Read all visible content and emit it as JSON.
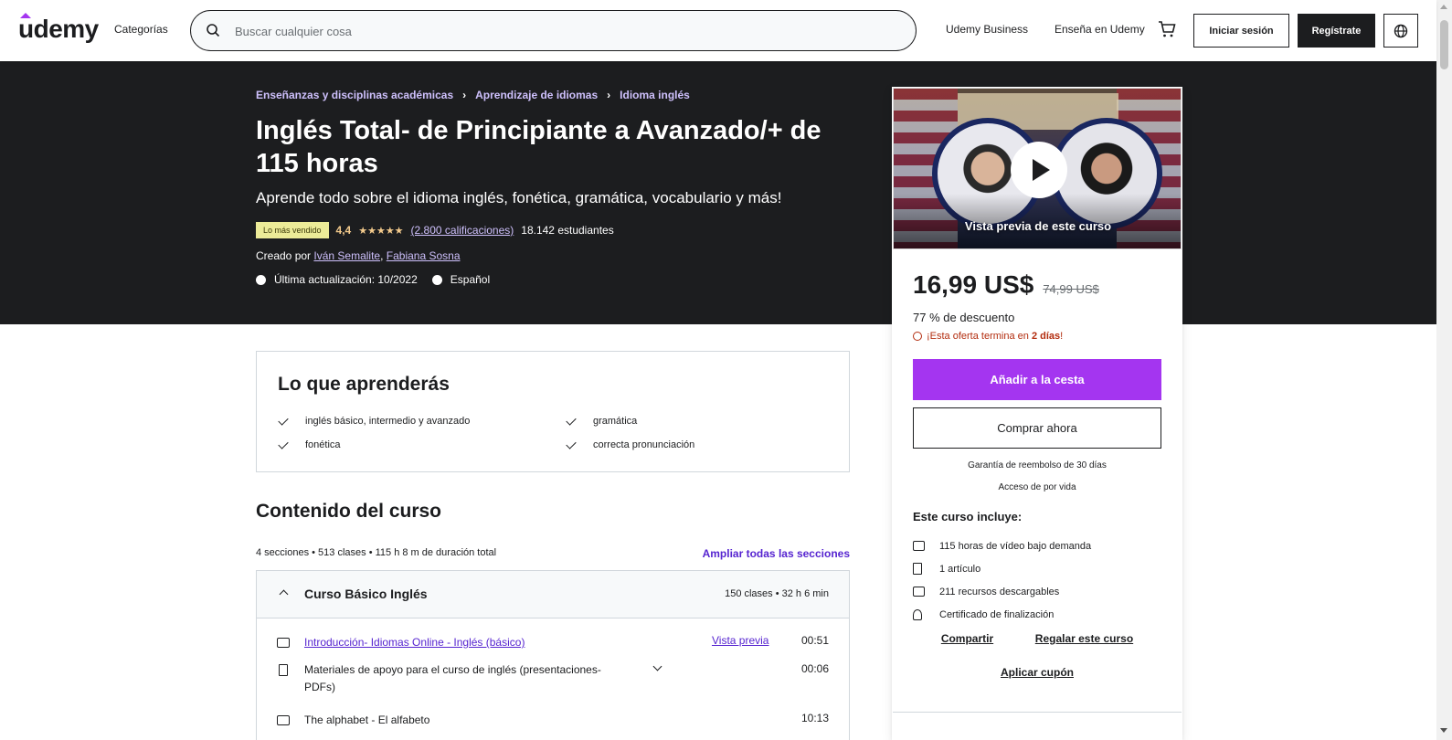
{
  "header": {
    "logo": "udemy",
    "categories_label": "Categorías",
    "search_placeholder": "Buscar cualquier cosa",
    "business_link": "Udemy Business",
    "teach_link": "Enseña en Udemy",
    "login_label": "Iniciar sesión",
    "signup_label": "Regístrate",
    "icons": [
      "search-icon",
      "cart-icon",
      "globe-icon"
    ]
  },
  "hero": {
    "breadcrumb": [
      "Enseñanzas y disciplinas académicas",
      "Aprendizaje de idiomas",
      "Idioma inglés"
    ],
    "title": "Inglés Total- de Principiante a Avanzado/+ de 115 horas",
    "subtitle": "Aprende todo sobre el idioma inglés, fonética, gramática, vocabulario y más!",
    "badge": "Lo más vendido",
    "rating": "4,4",
    "ratings_count": "(2.800 calificaciones)",
    "students": "18.142 estudiantes",
    "created_by_label": "Creado por",
    "instructors": [
      "Iván Semalite",
      "Fabiana Sosna"
    ],
    "last_update": "Última actualización: 10/2022",
    "language": "Español"
  },
  "card": {
    "preview_label": "Vista previa de este curso",
    "price": "16,99 US$",
    "old_price": "74,99 US$",
    "discount": "77 % de descuento",
    "offer_prefix": "¡Esta oferta termina en ",
    "offer_time": "2 días",
    "offer_suffix": "!",
    "add_to_cart": "Añadir a la cesta",
    "buy_now": "Comprar ahora",
    "guarantee": "Garantía de reembolso de 30 días",
    "access": "Acceso de por vida",
    "includes_title": "Este curso incluye:",
    "includes": [
      "115 horas de vídeo bajo demanda",
      "1 artículo",
      "211 recursos descargables",
      "Certificado de finalización"
    ],
    "share": "Compartir",
    "gift": "Regalar este curso",
    "coupon": "Aplicar cupón"
  },
  "learn": {
    "title": "Lo que aprenderás",
    "items": [
      "inglés básico, intermedio y avanzado",
      "gramática",
      "fonética",
      "correcta pronunciación"
    ]
  },
  "content": {
    "title": "Contenido del curso",
    "meta": "4 secciones • 513 clases • 115 h 8 m de duración total",
    "expand_all": "Ampliar todas las secciones",
    "section": {
      "title": "Curso Básico Inglés",
      "meta": "150 clases • 32 h 6 min",
      "lessons": [
        {
          "title": "Introducción- Idiomas Online - Inglés (básico)",
          "preview": "Vista previa",
          "time": "00:51"
        },
        {
          "title": "Materiales de apoyo para el curso de inglés (presentaciones- PDFs)",
          "time": "00:06"
        },
        {
          "title": "The alphabet - El alfabeto",
          "time": "10:13"
        }
      ]
    }
  },
  "colors": {
    "accent": "#a435f0",
    "hero_bg": "#1c1d1f",
    "link_purple": "#5624d0",
    "breadcrumb": "#cec0fc",
    "rating": "#f3ca8c",
    "badge_bg": "#eceb98",
    "offer_red": "#b32d0f"
  }
}
